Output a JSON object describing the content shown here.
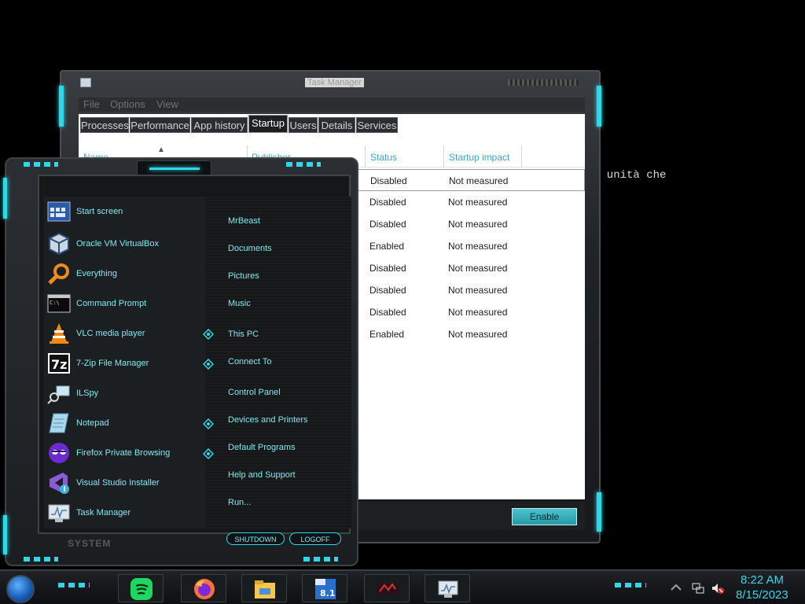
{
  "background": {
    "console_text": "e unità che"
  },
  "task_manager": {
    "title": "Task Manager",
    "menu": [
      "File",
      "Options",
      "View"
    ],
    "tabs": [
      "Processes",
      "Performance",
      "App history",
      "Startup",
      "Users",
      "Details",
      "Services"
    ],
    "active_tab": "Startup",
    "columns": {
      "name": "Name",
      "publisher": "Publisher",
      "status": "Status",
      "impact": "Startup impact"
    },
    "rows": [
      {
        "status": "Disabled",
        "impact": "Not measured"
      },
      {
        "status": "Disabled",
        "impact": "Not measured"
      },
      {
        "status": "Disabled",
        "impact": "Not measured"
      },
      {
        "status": "Enabled",
        "impact": "Not measured"
      },
      {
        "status": "Disabled",
        "impact": "Not measured"
      },
      {
        "status": "Disabled",
        "impact": "Not measured"
      },
      {
        "status": "Disabled",
        "impact": "Not measured"
      },
      {
        "status": "Enabled",
        "impact": "Not measured"
      }
    ],
    "enable_button": "Enable"
  },
  "start_menu": {
    "programs": [
      {
        "label": "Start screen",
        "icon": "start-screen-icon"
      },
      {
        "label": "Oracle VM VirtualBox",
        "icon": "virtualbox-icon"
      },
      {
        "label": "Everything",
        "icon": "magnifier-icon"
      },
      {
        "label": "Command Prompt",
        "icon": "command-prompt-icon"
      },
      {
        "label": "VLC media player",
        "icon": "vlc-cone-icon"
      },
      {
        "label": "7-Zip File Manager",
        "icon": "7zip-icon"
      },
      {
        "label": "ILSpy",
        "icon": "ilspy-icon"
      },
      {
        "label": "Notepad",
        "icon": "notepad-icon"
      },
      {
        "label": "Firefox Private Browsing",
        "icon": "firefox-private-icon"
      },
      {
        "label": "Visual Studio Installer",
        "icon": "visual-studio-installer-icon"
      },
      {
        "label": "Task Manager",
        "icon": "task-manager-icon"
      }
    ],
    "places": [
      "MrBeast",
      "Documents",
      "Pictures",
      "Music",
      "This PC",
      "Connect To",
      "Control Panel",
      "Devices and Printers",
      "Default Programs",
      "Help and Support",
      "Run..."
    ],
    "system_label": "SYSTEM",
    "shutdown_label": "SHUTDOWN",
    "logoff_label": "LOGOFF"
  },
  "taskbar": {
    "pinned": [
      "spotify-icon",
      "firefox-icon",
      "file-explorer-icon",
      "windows-8-1-icon",
      "media-player-icon",
      "task-manager-icon"
    ],
    "time": "8:22 AM",
    "date": "8/15/2023"
  },
  "colors": {
    "accent": "#2fd8e8",
    "text_accent": "#7fe8f2",
    "clock": "#3fd4e6"
  }
}
